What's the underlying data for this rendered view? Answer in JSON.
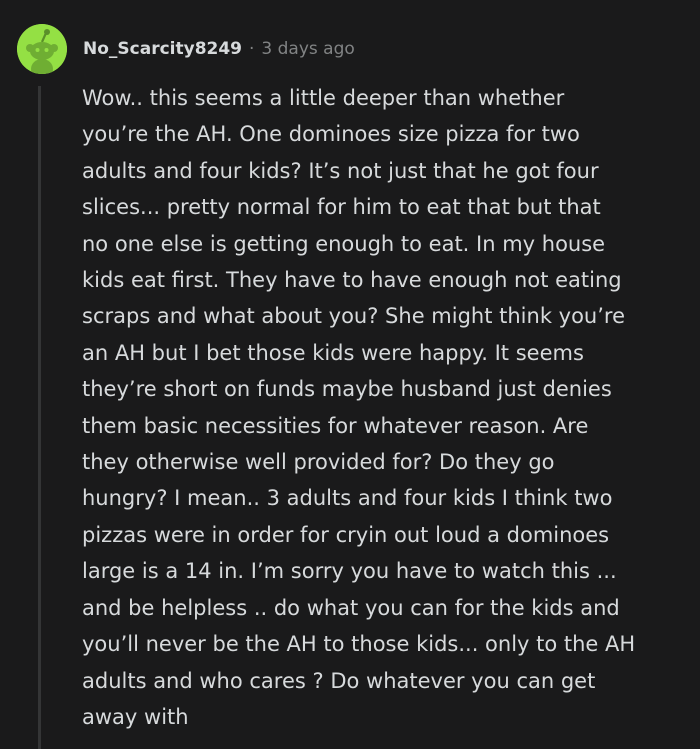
{
  "comment": {
    "author": "No_Scarcity8249",
    "separator": "·",
    "timestamp": "3 days ago",
    "avatar_color": "#94e044",
    "avatar_icon": "reddit-snoo-avatar-icon",
    "body_lines": [
      "Wow.. this seems a little deeper than whether",
      "you’re the AH. One dominoes size pizza for two",
      "adults and four kids? It’s not just that he got four",
      "slices... pretty normal for him to eat that but that",
      "no one else is getting enough to eat. In my house",
      "kids eat first. They have to have enough not eating",
      "scraps and what about you? She might think you’re",
      "an AH but I bet those kids were happy. It seems",
      "they’re short on funds maybe husband just denies",
      "them basic necessities for whatever reason. Are",
      "they otherwise well provided for? Do they go",
      "hungry? I mean.. 3 adults and four kids I think two",
      "pizzas were in order for cryin out loud a dominoes",
      "large is a 14 in. I’m sorry you have to watch this ...",
      "and be helpless .. do what you can for the kids and",
      "you’ll never be the AH to those kids... only to the AH",
      "adults and who cares ? Do whatever you can get",
      "away with"
    ]
  }
}
